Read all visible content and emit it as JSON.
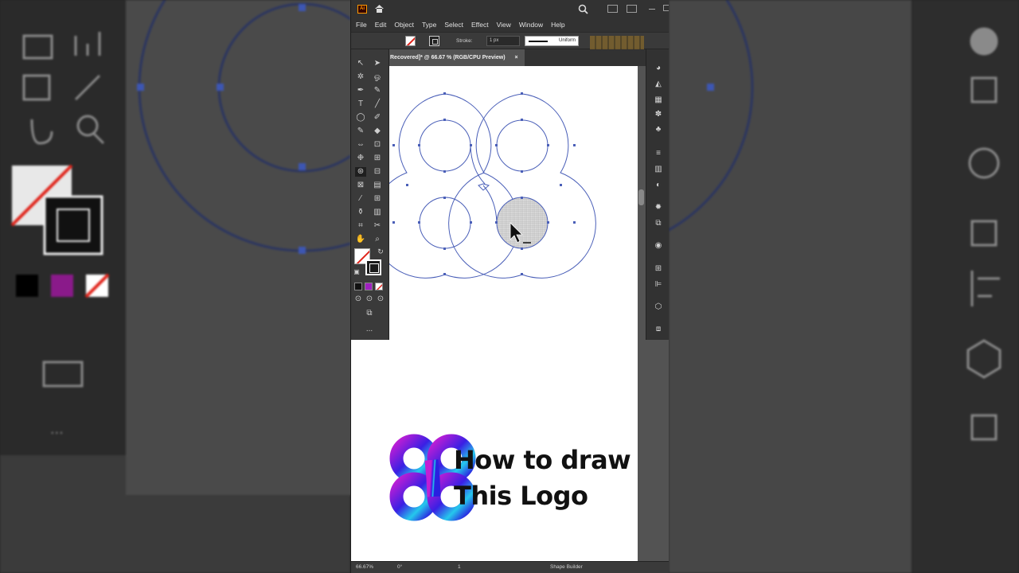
{
  "menu": [
    "File",
    "Edit",
    "Object",
    "Type",
    "Select",
    "Effect",
    "View",
    "Window",
    "Help"
  ],
  "app_logo": "Ai",
  "control": {
    "stroke_label": "Stroke:",
    "stroke_weight": "1 px",
    "profile": "Uniform"
  },
  "document_tab": {
    "title": "Recovered]* @ 66.67 % (RGB/CPU Preview)",
    "close": "×"
  },
  "status": {
    "zoom": "66.67%",
    "rotation": "0°",
    "artboard": "1",
    "tool_name": "Shape Builder"
  },
  "headline": {
    "line1": "How to draw",
    "line2": "This Logo"
  },
  "colors": {
    "logo_gradient": [
      "#b21fd8",
      "#2e1fe0",
      "#27c5e8"
    ],
    "selection": "#3d56b3",
    "fill_none_red": "#e0241b"
  },
  "toolbox_more": "...",
  "bg_more": "..."
}
